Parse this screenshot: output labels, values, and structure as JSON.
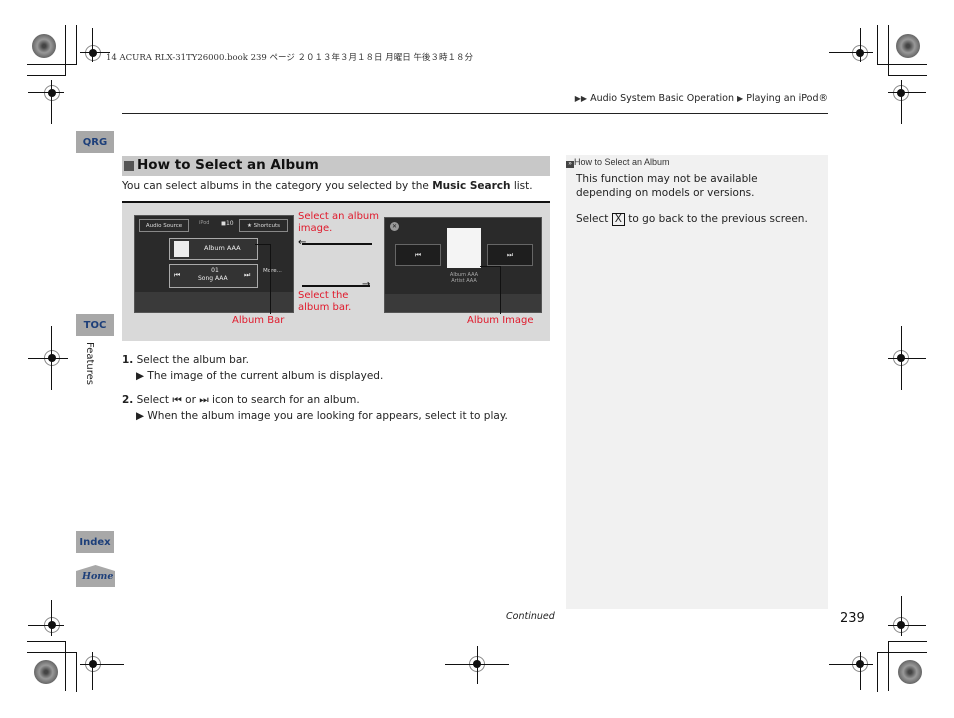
{
  "print_header": "14 ACURA RLX-31TY26000.book  239 ページ  ２０１３年３月１８日  月曜日  午後３時１８分",
  "breadcrumb": {
    "marker": "▶▶",
    "items": [
      "Audio System Basic Operation",
      "Playing an iPod®"
    ],
    "separator": "▶"
  },
  "nav_tabs": {
    "qrg": "QRG",
    "toc": "TOC",
    "index": "Index",
    "home": "Home"
  },
  "chapter_label": "Features",
  "section": {
    "title": "How to Select an Album",
    "intro_before": "You can select albums in the category you selected by the ",
    "intro_bold": "Music Search",
    "intro_after": " list."
  },
  "figure": {
    "left_screen": {
      "audio_source": "Audio Source",
      "ipod": "iPod",
      "volume": "10",
      "shortcuts": "★  Shortcuts",
      "album_bar": "Album AAA",
      "track_no": "01",
      "song": "Song AAA",
      "more": "More..."
    },
    "right_screen": {
      "album": "Album AAA",
      "artist": "Artist AAA"
    },
    "callouts": {
      "select_image": "Select an album image.",
      "select_bar": "Select the album bar.",
      "album_bar": "Album Bar",
      "album_image": "Album Image"
    },
    "accent_color": "#e0192b"
  },
  "steps": [
    {
      "num": "1.",
      "text": "Select the album bar.",
      "result": "The image of the current album is displayed."
    },
    {
      "num": "2.",
      "text_before": "Select ",
      "prev_icon": "⏮",
      "or": " or ",
      "next_icon": "⏭",
      "text_after": " icon to search for an album.",
      "result": "When the album image you are looking for appears, select it to play."
    }
  ],
  "sidebar_note": {
    "heading": "How to Select an Album",
    "para1": "This function may not be available depending on models or versions.",
    "para2_before": "Select ",
    "para2_icon": "X",
    "para2_after": " to go back to the previous screen."
  },
  "footer": {
    "continued": "Continued",
    "page_number": "239"
  }
}
